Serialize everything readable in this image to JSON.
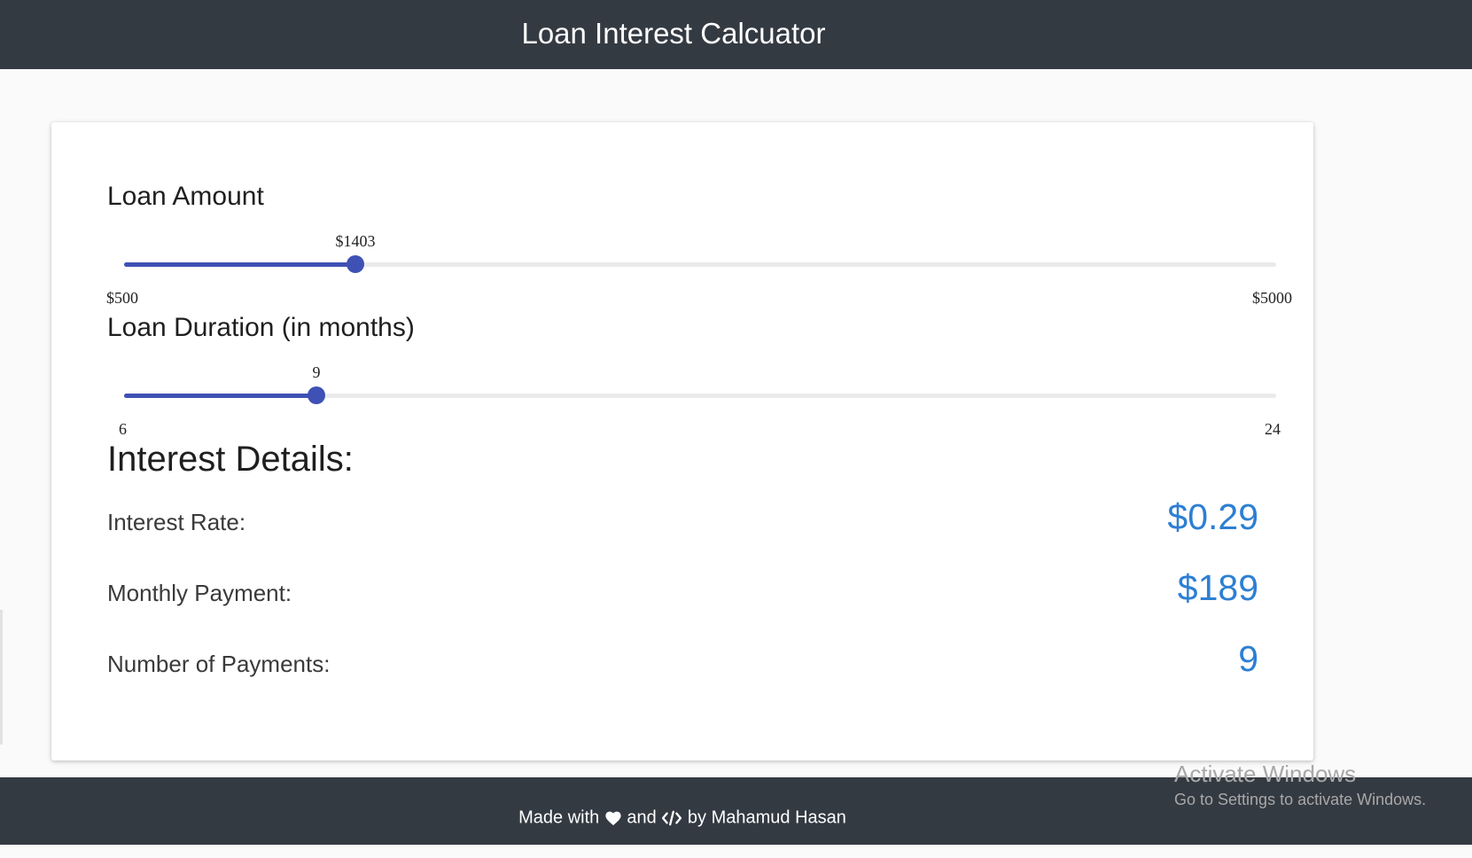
{
  "header": {
    "title": "Loan Interest Calcuator"
  },
  "loan_amount": {
    "label": "Loan Amount",
    "value_display": "$1403",
    "value": 1403,
    "min": 500,
    "max": 5000,
    "min_label": "$500",
    "max_label": "$5000"
  },
  "loan_duration": {
    "label": "Loan Duration (in months)",
    "value_display": "9",
    "value": 9,
    "min": 6,
    "max": 24,
    "min_label": "6",
    "max_label": "24"
  },
  "details": {
    "title": "Interest Details:",
    "interest_rate_label": "Interest Rate:",
    "interest_rate_value": "$0.29",
    "monthly_payment_label": "Monthly Payment:",
    "monthly_payment_value": "$189",
    "num_payments_label": "Number of Payments:",
    "num_payments_value": "9"
  },
  "footer": {
    "made_with": "Made with",
    "and": "and",
    "by": "by Mahamud Hasan",
    "heart_icon": "heart-icon",
    "code_icon": "code-icon"
  },
  "watermark": {
    "line1": "Activate Windows",
    "line2": "Go to Settings to activate Windows."
  },
  "colors": {
    "header_bg": "#343a42",
    "slider_accent": "#3f51b5",
    "value_blue": "#2d7fd3"
  }
}
